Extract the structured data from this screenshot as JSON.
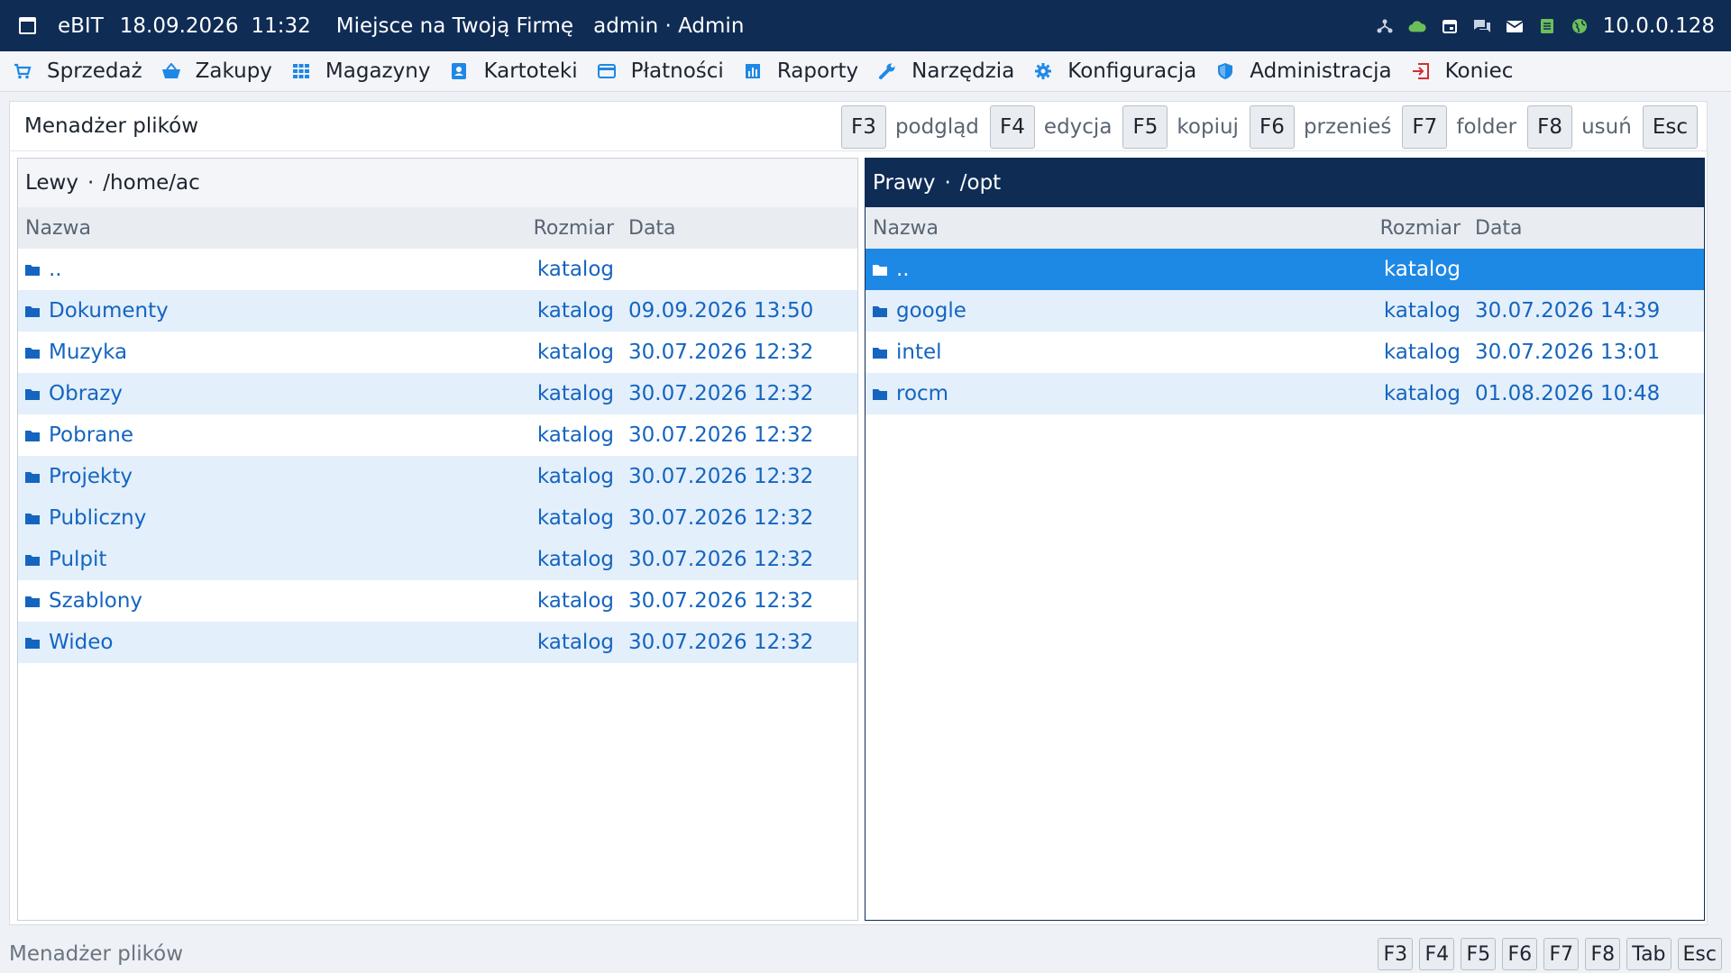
{
  "titlebar": {
    "app": "eBIT",
    "date": "18.09.2026",
    "time": "11:32",
    "company": "Miejsce na Twoją Firmę",
    "user": "admin · Admin",
    "ip": "10.0.0.128"
  },
  "menu": [
    {
      "label": "Sprzedaż",
      "icon": "cart-icon"
    },
    {
      "label": "Zakupy",
      "icon": "basket-icon"
    },
    {
      "label": "Magazyny",
      "icon": "grid-icon"
    },
    {
      "label": "Kartoteki",
      "icon": "contact-card-icon"
    },
    {
      "label": "Płatności",
      "icon": "credit-card-icon"
    },
    {
      "label": "Raporty",
      "icon": "bar-chart-icon"
    },
    {
      "label": "Narzędzia",
      "icon": "wrench-icon"
    },
    {
      "label": "Konfiguracja",
      "icon": "gear-icon"
    },
    {
      "label": "Administracja",
      "icon": "shield-icon"
    },
    {
      "label": "Koniec",
      "icon": "exit-icon"
    }
  ],
  "main": {
    "title": "Menadżer plików",
    "fkeys": [
      {
        "key": "F3",
        "desc": "podgląd"
      },
      {
        "key": "F4",
        "desc": "edycja"
      },
      {
        "key": "F5",
        "desc": "kopiuj"
      },
      {
        "key": "F6",
        "desc": "przenieś"
      },
      {
        "key": "F7",
        "desc": "folder"
      },
      {
        "key": "F8",
        "desc": "usuń"
      },
      {
        "key": "Esc",
        "desc": ""
      }
    ]
  },
  "columns": {
    "name": "Nazwa",
    "size": "Rozmiar",
    "date": "Data"
  },
  "left_pane": {
    "label": "Lewy",
    "path": "/home/ac",
    "rows": [
      {
        "name": "..",
        "size": "katalog",
        "date": ""
      },
      {
        "name": "Dokumenty",
        "size": "katalog",
        "date": "09.09.2026 13:50"
      },
      {
        "name": "Muzyka",
        "size": "katalog",
        "date": "30.07.2026 12:32"
      },
      {
        "name": "Obrazy",
        "size": "katalog",
        "date": "30.07.2026 12:32"
      },
      {
        "name": "Pobrane",
        "size": "katalog",
        "date": "30.07.2026 12:32"
      },
      {
        "name": "Projekty",
        "size": "katalog",
        "date": "30.07.2026 12:32"
      },
      {
        "name": "Publiczny",
        "size": "katalog",
        "date": "30.07.2026 12:32"
      },
      {
        "name": "Pulpit",
        "size": "katalog",
        "date": "30.07.2026 12:32"
      },
      {
        "name": "Szablony",
        "size": "katalog",
        "date": "30.07.2026 12:32"
      },
      {
        "name": "Wideo",
        "size": "katalog",
        "date": "30.07.2026 12:32"
      }
    ]
  },
  "right_pane": {
    "label": "Prawy",
    "path": "/opt",
    "rows": [
      {
        "name": "..",
        "size": "katalog",
        "date": ""
      },
      {
        "name": "google",
        "size": "katalog",
        "date": "30.07.2026 14:39"
      },
      {
        "name": "intel",
        "size": "katalog",
        "date": "30.07.2026 13:01"
      },
      {
        "name": "rocm",
        "size": "katalog",
        "date": "01.08.2026 10:48"
      }
    ]
  },
  "statusbar": {
    "text": "Menadżer plików",
    "keys": [
      "F3",
      "F4",
      "F5",
      "F6",
      "F7",
      "F8",
      "Tab",
      "Esc"
    ]
  },
  "colors": {
    "titlebar": "#0f2c55",
    "accent": "#1565c0",
    "selected_row": "#1e88e5",
    "alt_row": "#e3effb"
  }
}
